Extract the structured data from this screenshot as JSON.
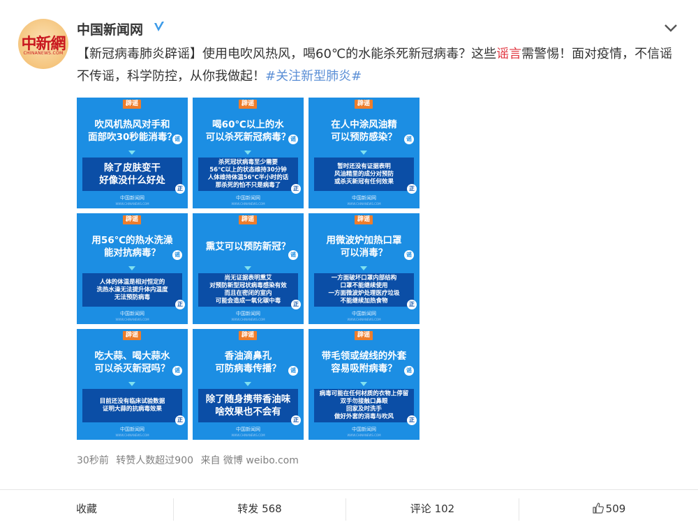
{
  "user": {
    "name": "中国新闻网",
    "avatar_text": "中新網",
    "avatar_subtext": "CHINANEWS.COM"
  },
  "post": {
    "text_part1": "【新冠病毒肺炎辟谣】使用电吹风热风，喝60℃的水能杀死新冠病毒？这些",
    "text_highlight": "谣言",
    "text_part2": "需警惕！面对疫情，不信谣不传谣，科学防控，从你我做起！",
    "hashtag": "#关注新型肺炎#"
  },
  "tiles": [
    {
      "badge": "辟谣",
      "question": "吹风机热风对手和\n面部吹30秒能消毒？",
      "answer": "除了皮肤变干\n好像没什么好处",
      "answer_size": "big",
      "mark_q": "谣",
      "mark_a": "正",
      "footer": "中国新闻网",
      "footer_sub": "WWW.CHINANEWS.COM"
    },
    {
      "badge": "辟谣",
      "question": "喝60℃以上的水\n可以杀死新冠病毒？",
      "answer": "杀死冠状病毒至少需要\n56℃以上的状态维持30分钟\n人体维持体温56℃半小时的话\n那杀死的怕不只是病毒了",
      "answer_size": "small",
      "mark_q": "谣",
      "mark_a": "正",
      "footer": "中国新闻网",
      "footer_sub": "WWW.CHINANEWS.COM"
    },
    {
      "badge": "辟谣",
      "question": "在人中涂风油精\n可以预防感染？",
      "answer": "暂时还没有证据表明\n风油精里的成分对预防\n或杀灭新冠有任何效果",
      "answer_size": "small",
      "mark_q": "谣",
      "mark_a": "正",
      "footer": "中国新闻网",
      "footer_sub": "WWW.CHINANEWS.COM"
    },
    {
      "badge": "辟谣",
      "question": "用56℃的热水洗澡\n能对抗病毒？",
      "answer": "人体的体温是相对恒定的\n洗热水澡无法提升体内温度\n无法预防病毒",
      "answer_size": "small",
      "mark_q": "谣",
      "mark_a": "正",
      "footer": "中国新闻网",
      "footer_sub": "WWW.CHINANEWS.COM"
    },
    {
      "badge": "辟谣",
      "question": "熏艾可以预防新冠？",
      "answer": "尚无证据表明熏艾\n对预防新型冠状病毒感染有效\n而且在密闭的室内\n可能会造成一氧化碳中毒",
      "answer_size": "small",
      "mark_q": "谣",
      "mark_a": "正",
      "footer": "中国新闻网",
      "footer_sub": "WWW.CHINANEWS.COM"
    },
    {
      "badge": "辟谣",
      "question": "用微波炉加热口罩\n可以消毒？",
      "answer": "一方面破坏口罩内部结构\n口罩不能继续使用\n一方面微波炉处理医疗垃圾\n不能继续加热食物",
      "answer_size": "small",
      "mark_q": "谣",
      "mark_a": "正",
      "footer": "中国新闻网",
      "footer_sub": "WWW.CHINANEWS.COM"
    },
    {
      "badge": "辟谣",
      "question": "吃大蒜、喝大蒜水\n可以杀灭新冠吗？",
      "answer": "目前还没有临床试验数据\n证明大蒜的抗病毒效果",
      "answer_size": "small",
      "mark_q": "谣",
      "mark_a": "正",
      "footer": "中国新闻网",
      "footer_sub": "WWW.CHINANEWS.COM"
    },
    {
      "badge": "辟谣",
      "question": "香油滴鼻孔\n可防病毒传播？",
      "answer": "除了随身携带香油味\n啥效果也不会有",
      "answer_size": "big",
      "mark_q": "谣",
      "mark_a": "正",
      "footer": "中国新闻网",
      "footer_sub": "WWW.CHINANEWS.COM"
    },
    {
      "badge": "辟谣",
      "question": "带毛领或绒线的外套\n容易吸附病毒？",
      "answer": "病毒可能在任何材质的衣物上停留\n双手勿接触口鼻眼\n回家及时洗手\n做好外套的消毒与吹风",
      "answer_size": "small",
      "mark_q": "谣",
      "mark_a": "正",
      "footer": "中国新闻网",
      "footer_sub": "WWW.CHINANEWS.COM"
    }
  ],
  "meta": {
    "time": "30秒前",
    "reposts_note": "转赞人数超过900",
    "source": "来自 微博 weibo.com"
  },
  "actions": {
    "favorite": "收藏",
    "repost": "转发 568",
    "comment": "评论 102",
    "like_count": "509"
  }
}
